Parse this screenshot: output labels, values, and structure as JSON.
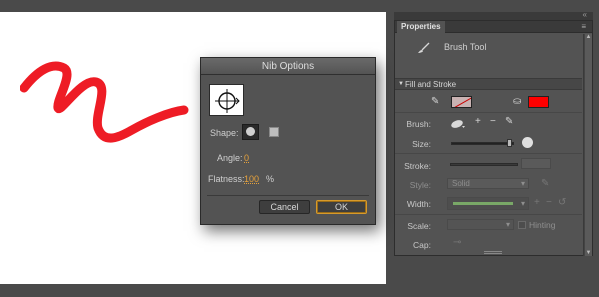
{
  "colors": {
    "stroke_red": "#ee1c25",
    "fill_swatch": "#ff0000",
    "primary_button_border": "#d79a2b",
    "value_orange": "#e6a23c"
  },
  "dialog": {
    "title": "Nib Options",
    "shape_label": "Shape:",
    "shape_options": [
      "round",
      "square"
    ],
    "selected_shape": "round",
    "angle_label": "Angle:",
    "angle_value": "0",
    "flatness_label": "Flatness:",
    "flatness_value": "100",
    "flatness_unit": "%",
    "cancel_label": "Cancel",
    "ok_label": "OK"
  },
  "properties": {
    "tab_label": "Properties",
    "tool_name": "Brush Tool",
    "section_title": "Fill and Stroke",
    "brush_label": "Brush:",
    "size_label": "Size:",
    "size_level": 0.97,
    "stroke_label": "Stroke:",
    "style_label": "Style:",
    "style_value": "Solid",
    "width_label": "Width:",
    "scale_label": "Scale:",
    "hinting_label": "Hinting",
    "cap_label": "Cap:"
  },
  "icons": {
    "panel_close": "close-icon",
    "panel_menu": "menu-icon",
    "tool": "brush-icon",
    "stroke_pencil": "pencil-icon",
    "fill_bucket": "paint-bucket-icon",
    "brush_shape": "brush-shape-icon",
    "add": "plus-icon",
    "remove": "minus-icon",
    "brush_edit": "pencil-icon",
    "width_reset": "reset-icon"
  }
}
